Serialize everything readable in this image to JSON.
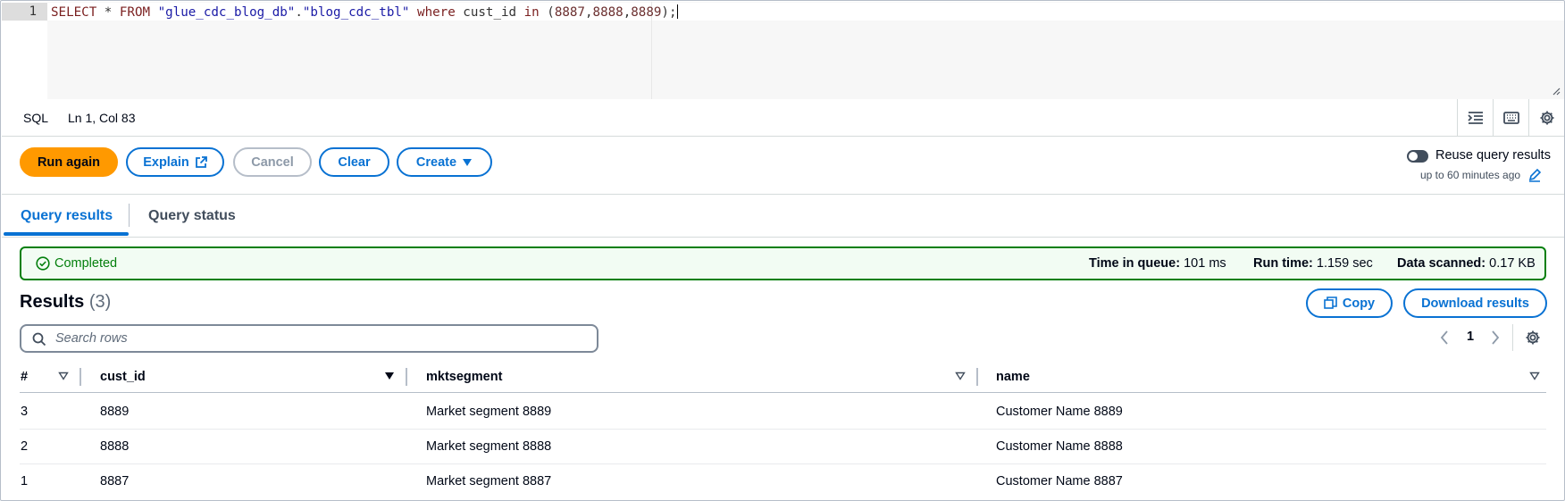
{
  "editor": {
    "line_number": "1",
    "query": {
      "t1": "SELECT",
      "t2": " * ",
      "t3": "FROM",
      "t4": " ",
      "t5": "\"glue_cdc_blog_db\"",
      "t6": ".",
      "t7": "\"blog_cdc_tbl\"",
      "t8": " ",
      "t9": "where",
      "t10": " cust_id ",
      "t11": "in",
      "t12": " (",
      "t13": "8887",
      "t14": ",",
      "t15": "8888",
      "t16": ",",
      "t17": "8889",
      "t18": ");"
    }
  },
  "statusbar": {
    "language": "SQL",
    "position": "Ln 1, Col 83",
    "icons": [
      "indent-icon",
      "keyboard-icon",
      "settings-icon"
    ]
  },
  "actions": {
    "run_again": "Run again",
    "explain": "Explain",
    "cancel": "Cancel",
    "clear": "Clear",
    "create": "Create",
    "reuse_label": "Reuse query results",
    "reuse_sub": "up to 60 minutes ago",
    "reuse_enabled": false
  },
  "tabs": [
    {
      "label": "Query results",
      "active": true
    },
    {
      "label": "Query status",
      "active": false
    }
  ],
  "banner": {
    "status": "Completed",
    "time_in_queue_label": "Time in queue:",
    "time_in_queue": "101 ms",
    "run_time_label": "Run time:",
    "run_time": "1.159 sec",
    "data_scanned_label": "Data scanned:",
    "data_scanned": "0.17 KB"
  },
  "results": {
    "title": "Results",
    "count": "(3)",
    "copy": "Copy",
    "download": "Download results",
    "search_placeholder": "Search rows",
    "page": "1",
    "columns": [
      "#",
      "cust_id",
      "mktsegment",
      "name"
    ],
    "rows": [
      {
        "n": "3",
        "cust_id": "8889",
        "mktsegment": "Market segment 8889",
        "name": "Customer Name 8889"
      },
      {
        "n": "2",
        "cust_id": "8888",
        "mktsegment": "Market segment 8888",
        "name": "Customer Name 8888"
      },
      {
        "n": "1",
        "cust_id": "8887",
        "mktsegment": "Market segment 8887",
        "name": "Customer Name 8887"
      }
    ]
  },
  "colors": {
    "primary": "#ff9900",
    "link": "#0972d3",
    "success": "#037f0c"
  }
}
